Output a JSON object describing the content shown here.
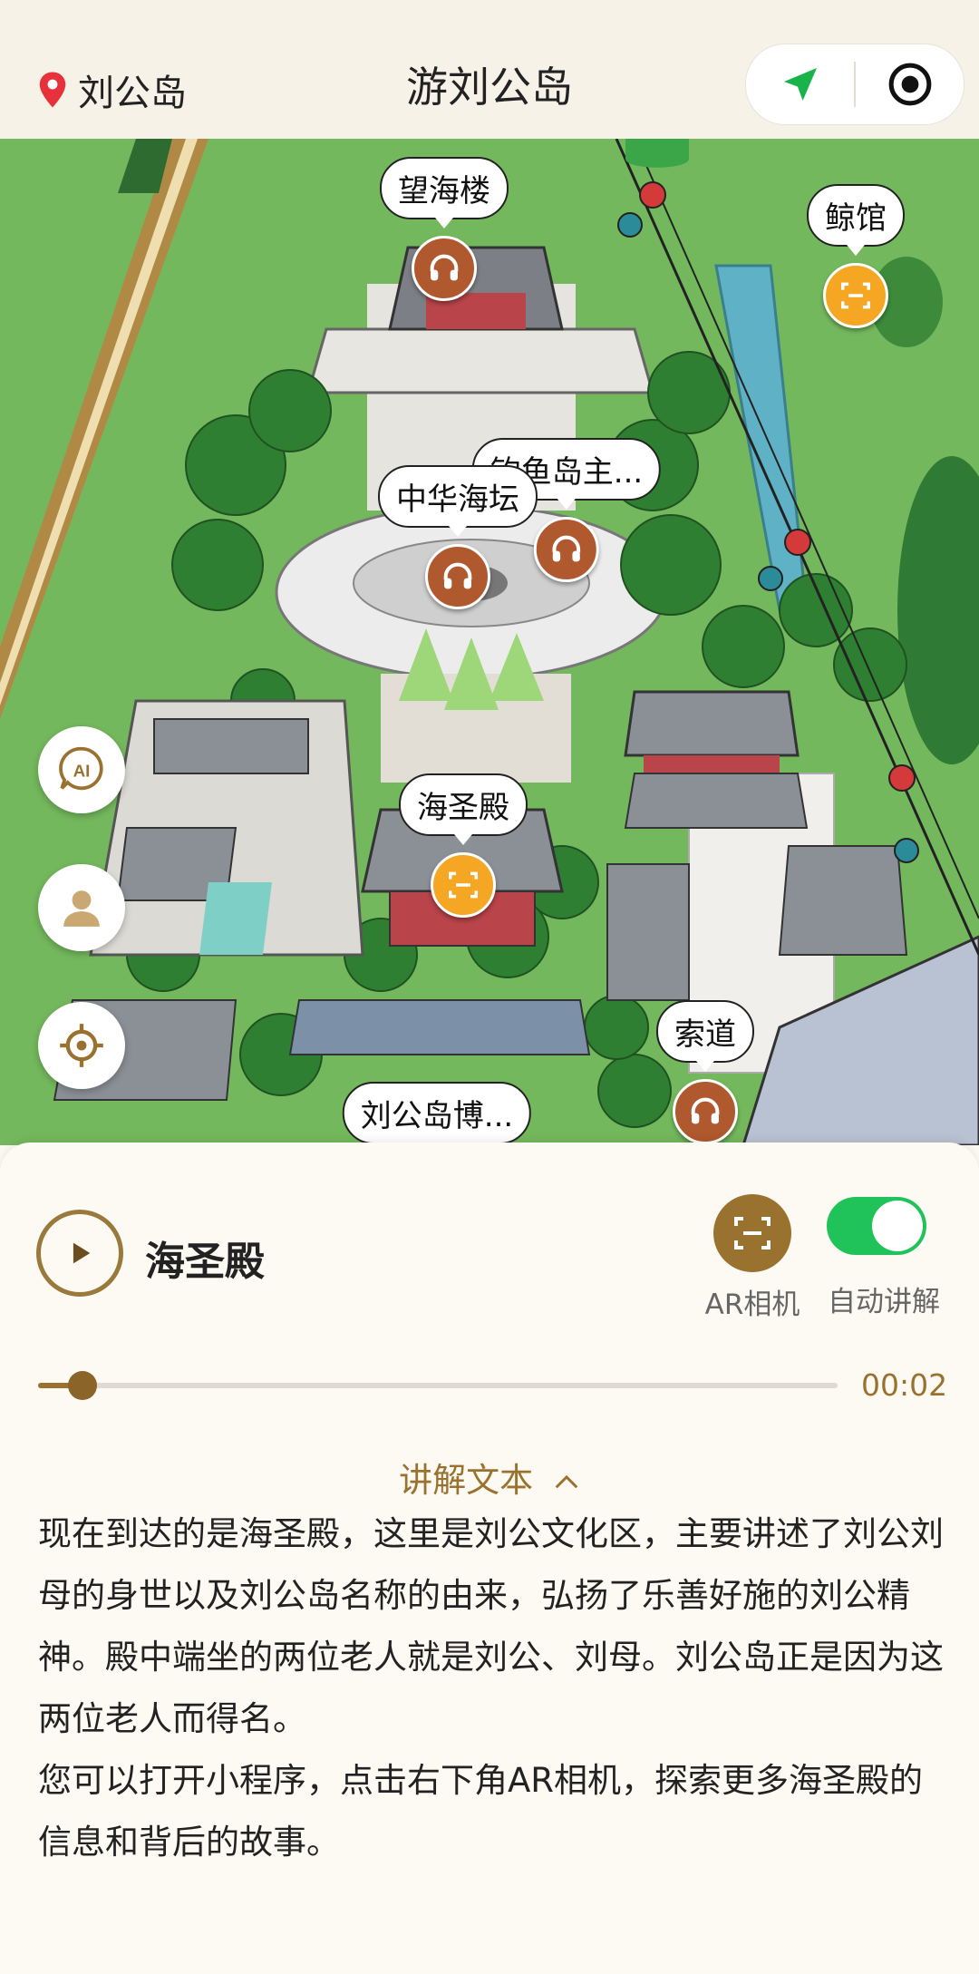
{
  "header": {
    "location_icon": "location-pin-icon",
    "location": "刘公岛",
    "title": "游刘公岛",
    "navigate_icon": "navigation-arrow-icon",
    "close_icon": "target-circle-icon"
  },
  "map": {
    "pois": [
      {
        "label": "望海楼",
        "marker": "audio"
      },
      {
        "label": "鲸馆",
        "marker": "ar"
      },
      {
        "label": "钓鱼岛主...",
        "marker": "audio"
      },
      {
        "label": "中华海坛",
        "marker": "audio"
      },
      {
        "label": "海圣殿",
        "marker": "ar"
      },
      {
        "label": "索道",
        "marker": "audio"
      },
      {
        "label": "刘公岛博...",
        "marker": "none"
      }
    ],
    "side_buttons": [
      "ai-icon",
      "user-icon",
      "locate-icon"
    ],
    "ai_label": "AI"
  },
  "player": {
    "spot_name": "海圣殿",
    "ar_label": "AR相机",
    "auto_label": "自动讲解",
    "auto_on": true,
    "time": "00:02",
    "progress": 0.055,
    "text_toggle": "讲解文本",
    "narration": [
      "现在到达的是海圣殿，这里是刘公文化区，主要讲述了刘公刘母的身世以及刘公岛名称的由来，弘扬了乐善好施的刘公精神。殿中端坐的两位老人就是刘公、刘母。刘公岛正是因为这两位老人而得名。",
      "您可以打开小程序，点击右下角AR相机，探索更多海圣殿的信息和背后的故事。"
    ]
  },
  "colors": {
    "accent": "#9a7230",
    "toggle_on": "#20c35a",
    "audio_marker": "#b0582e",
    "ar_marker": "#f5a623"
  }
}
